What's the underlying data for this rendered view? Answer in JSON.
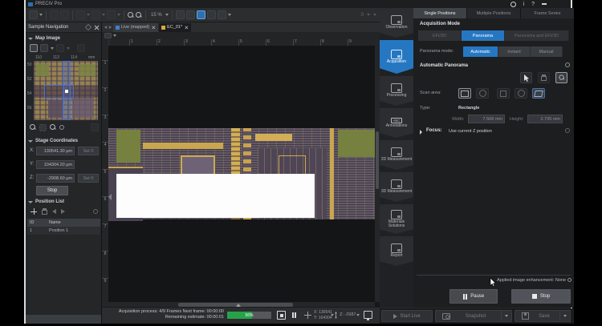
{
  "window": {
    "title": "PRECiV Pro",
    "info_glyph": "i",
    "help_glyph": "?"
  },
  "toolbar": {
    "zoom_level": "15 %",
    "counter": "0"
  },
  "left_panel": {
    "title": "Sample Navigation",
    "map_image": {
      "label": "Map Image",
      "ruler_top": [
        "110",
        "112",
        "114"
      ],
      "ruler_unit": "mm",
      "ruler_left": [
        "50",
        "52",
        "54",
        "56"
      ]
    },
    "stage": {
      "label": "Stage Coordinates",
      "x_label": "X:",
      "x_value": "130541.30 µm",
      "y_label": "Y:",
      "y_value": "104304.20 µm",
      "z_label": "Z:",
      "z_value": "-2908.60 µm",
      "set0": "Set 0",
      "stop": "Stop"
    },
    "positions": {
      "label": "Position List",
      "col_id": "ID",
      "col_name": "Name",
      "rows": [
        {
          "id": "1",
          "name": "Position 1"
        }
      ]
    }
  },
  "center": {
    "tab_live": "Live (mapped)",
    "tab_doc": "EC_01*",
    "ruler_h": [
      "1",
      "2",
      "3",
      "4",
      "5",
      "6",
      "7",
      "8",
      "9"
    ],
    "ruler_v": [
      "1",
      "2",
      "3",
      "4",
      "5",
      "6",
      "7",
      "8",
      "9"
    ],
    "status": {
      "line1": "Acquisition process: 4/9 Frames   Next frame: 00:00:00",
      "line2": "Remaining estimate: 00:00:01",
      "progress_label": "56%",
      "progress_percent": 56,
      "x": "X: 130541",
      "y": "Y: 104304",
      "z": "Z: -2987"
    }
  },
  "right_panel": {
    "tabs": [
      "Single Positions",
      "Multiple Positions",
      "Frame Series"
    ],
    "nav": [
      "Observation",
      "Acquisition",
      "Processing",
      "Annotations",
      "2D Measurement",
      "3D Measurement",
      "Materials Solutions",
      "Report"
    ],
    "annotations_icon_text": "ABC",
    "acq_mode_label": "Acquisition Mode",
    "acq_modes": [
      "EFI/3D",
      "Panorama",
      "Panorama and EFI/3D"
    ],
    "pano_mode_label": "Panorama mode:",
    "pano_modes": [
      "Automatic",
      "Instant",
      "Manual"
    ],
    "auto_pano_label": "Automatic Panorama",
    "scan_area_label": "Scan area:",
    "type_label": "Type:",
    "type_value": "Rectangle",
    "width_label": "Width:",
    "width_value": "7.568 mm",
    "height_label": "Height:",
    "height_value": "2.735 mm",
    "focus_label": "Focus:",
    "focus_value": "Use current Z position",
    "enhancement": "Applied image enhancement: None",
    "pause": "Pause",
    "stop": "Stop",
    "start_live": "Start Live",
    "snapshot": "Snapshot",
    "save": "Save"
  },
  "colors": {
    "accent_blue": "#2677c2",
    "progress_green": "#27a24a"
  }
}
